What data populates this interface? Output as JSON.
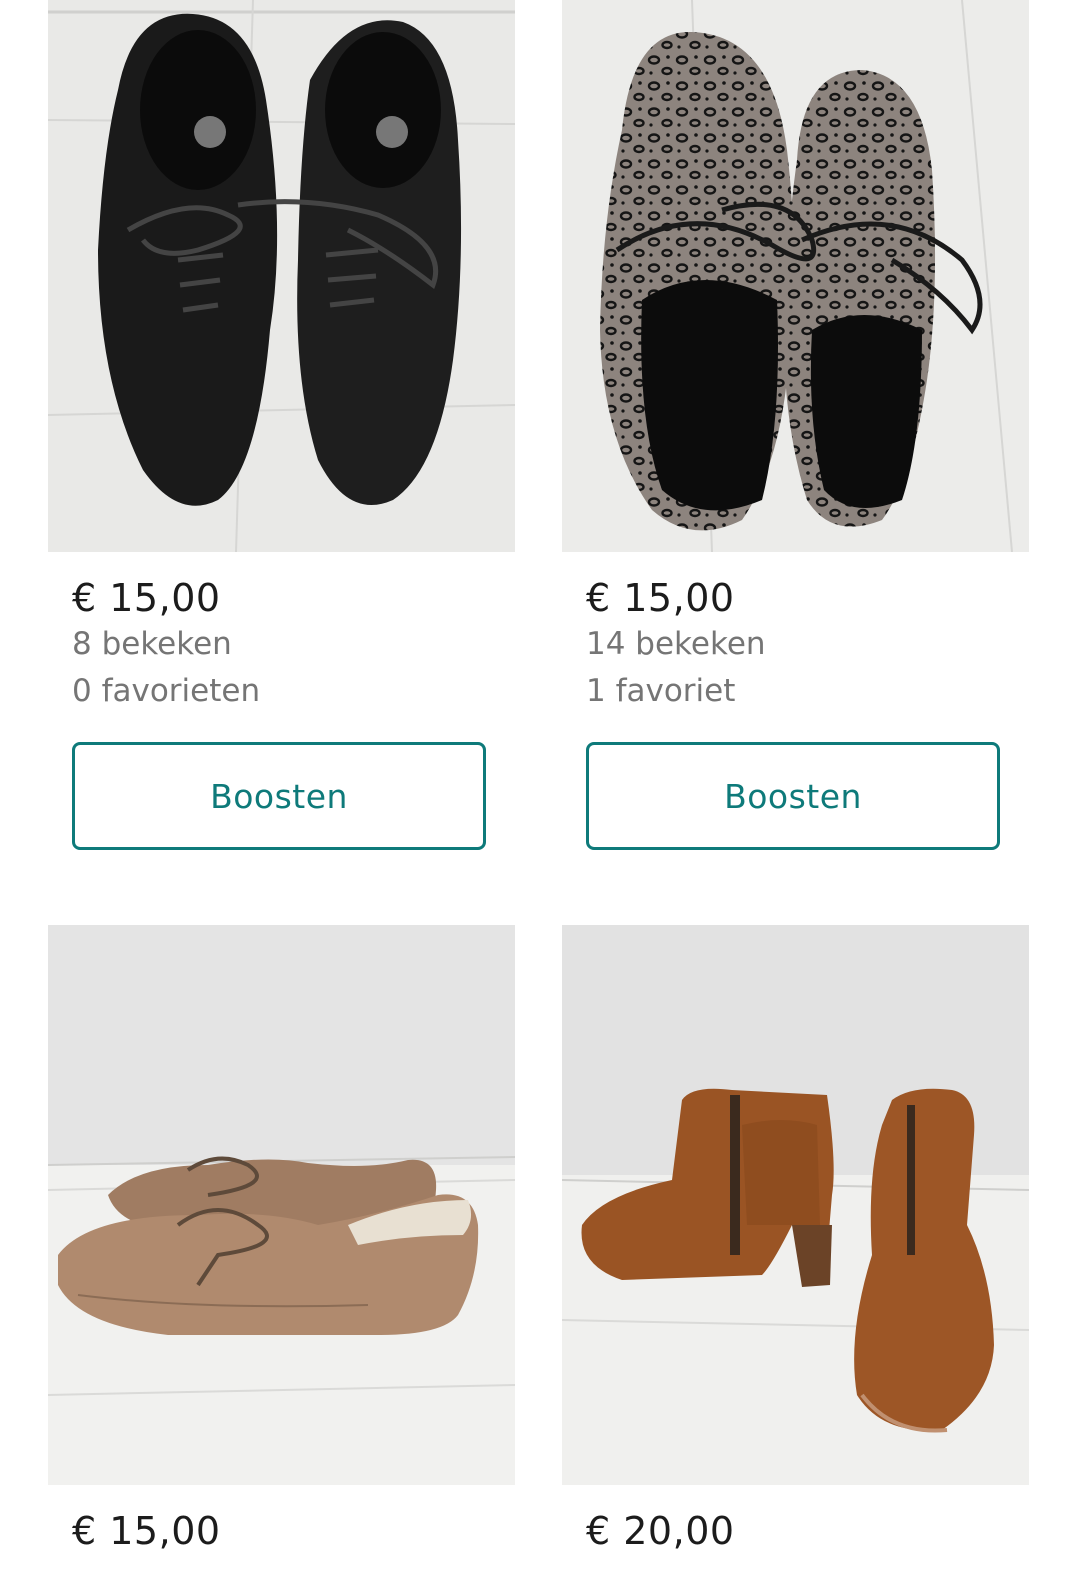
{
  "items": [
    {
      "image": "black-suede-lace-up-shoes",
      "price": "€ 15,00",
      "views": "8 bekeken",
      "favorites": "0 favorieten",
      "boost_label": "Boosten"
    },
    {
      "image": "leopard-print-lace-up-ankle-boots",
      "price": "€ 15,00",
      "views": "14 bekeken",
      "favorites": "1 favoriet",
      "boost_label": "Boosten"
    },
    {
      "image": "beige-suede-lace-up-shoes",
      "price": "€ 15,00",
      "views": "",
      "favorites": "",
      "boost_label": ""
    },
    {
      "image": "cognac-suede-heeled-ankle-boots",
      "price": "€ 20,00",
      "views": "",
      "favorites": "",
      "boost_label": ""
    }
  ],
  "colors": {
    "accent": "#0e7a7a",
    "price_text": "#1c1c1c",
    "meta_text": "#757575"
  }
}
